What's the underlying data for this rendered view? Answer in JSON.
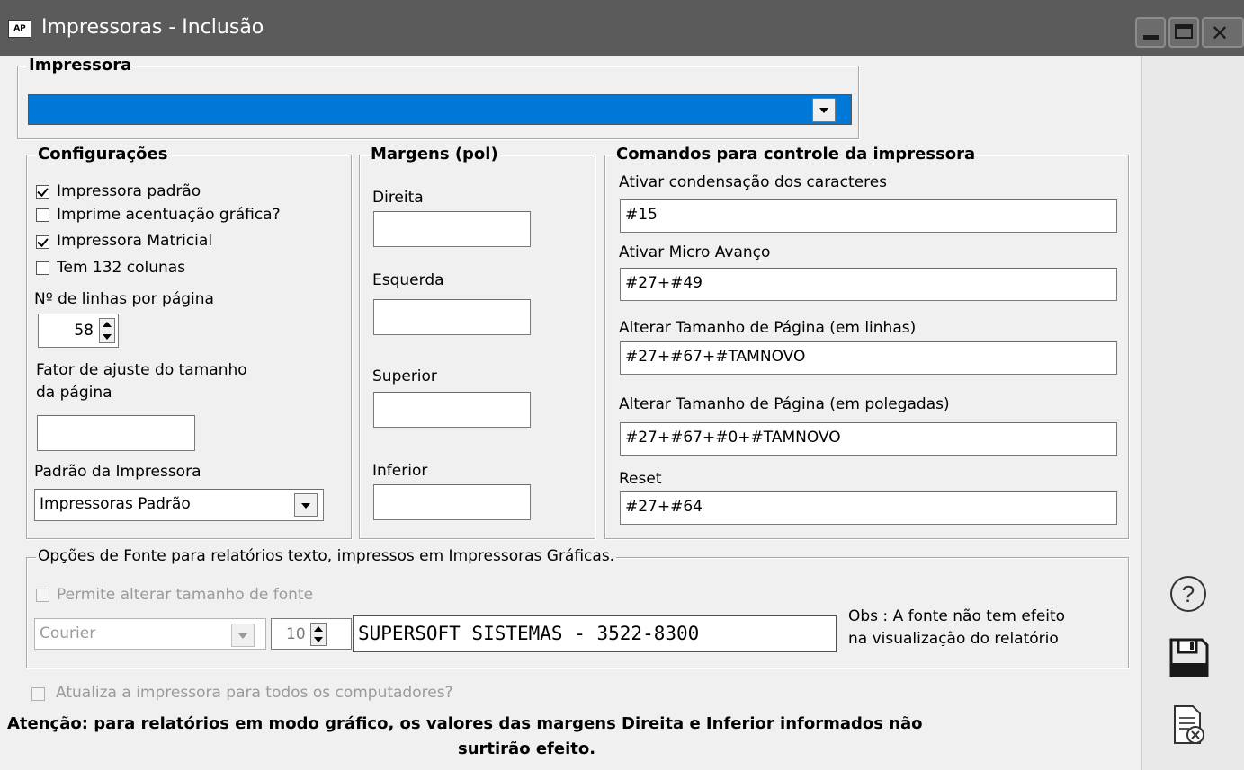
{
  "window": {
    "title": "Impressoras - Inclusão",
    "app_icon_text": "AP",
    "controls": [
      "minimize-icon",
      "maximize-icon",
      "close-icon"
    ]
  },
  "impressora": {
    "group_label": "Impressora",
    "selected_value": ""
  },
  "configuracoes": {
    "group_label": "Configurações",
    "checkboxes": [
      {
        "label": "Impressora padrão",
        "checked": true
      },
      {
        "label": "Imprime acentuação gráfica?",
        "checked": false
      },
      {
        "label": "Impressora Matricial",
        "checked": true
      },
      {
        "label": "Tem 132 colunas",
        "checked": false
      }
    ],
    "linhas_label": "Nº de linhas por página",
    "linhas_value": "58",
    "fator_label_1": "Fator de ajuste do tamanho",
    "fator_label_2": "da página",
    "fator_value": "",
    "padrao_label": "Padrão da Impressora",
    "padrao_value": "Impressoras Padrão"
  },
  "margens": {
    "group_label": "Margens (pol)",
    "direita_label": "Direita",
    "direita_value": "",
    "esquerda_label": "Esquerda",
    "esquerda_value": "",
    "superior_label": "Superior",
    "superior_value": "",
    "inferior_label": "Inferior",
    "inferior_value": ""
  },
  "comandos": {
    "group_label": "Comandos para controle da impressora",
    "fields": [
      {
        "label": "Ativar condensação dos caracteres",
        "value": "#15"
      },
      {
        "label": "Ativar Micro Avanço",
        "value": "#27+#49"
      },
      {
        "label": "Alterar Tamanho de Página (em linhas)",
        "value": "#27+#67+#TAMNOVO"
      },
      {
        "label": "Alterar Tamanho de Página (em polegadas)",
        "value": "#27+#67+#0+#TAMNOVO"
      },
      {
        "label": "Reset",
        "value": "#27+#64"
      }
    ]
  },
  "fonte": {
    "group_label": "Opções de Fonte para relatórios texto, impressos em Impressoras Gráficas.",
    "permite_label": "Permite alterar tamanho de fonte",
    "font_name": "Courier",
    "font_size": "10",
    "preview_text": "SUPERSOFT SISTEMAS - 3522-8300",
    "obs_1": "Obs : A fonte não tem efeito",
    "obs_2": "na visualização do relatório"
  },
  "atualiza_label": "Atualiza a impressora para todos os computadores?",
  "atencao_1": "Atenção: para relatórios em modo gráfico, os valores das margens Direita e Inferior informados não",
  "atencao_2": "surtirão efeito.",
  "sidebar_icons": [
    "help-icon",
    "save-icon",
    "cancel-icon"
  ],
  "colors": {
    "titlebar": "#5b5b5b",
    "selection": "#0078d7",
    "background": "#f0f0f0"
  }
}
